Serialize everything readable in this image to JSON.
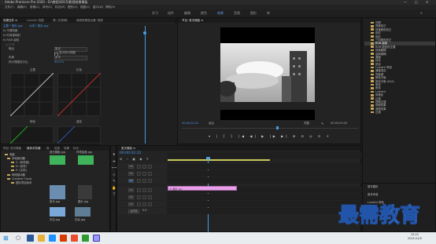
{
  "window": {
    "title": "Adobe Premiere Pro 2020 - D:\\教程\\0015\\影视效果模板",
    "controls": [
      "—",
      "□",
      "✕"
    ]
  },
  "menu": [
    "文件(F)",
    "编辑(E)",
    "剪辑(C)",
    "序列(S)",
    "标记(M)",
    "图形(G)",
    "视图(V)",
    "窗口(W)",
    "帮助(H)"
  ],
  "workspaces": [
    "学习",
    "组件",
    "编辑",
    "颜色",
    "效果",
    "音频",
    "图形",
    "库"
  ],
  "workspace_active_index": 4,
  "effect_controls": {
    "tabs": [
      "效果控件 ≡",
      "Lumetri 范围",
      "源: (无剪辑)",
      "音频剪辑混合器: 视频"
    ],
    "source_label": "主要 * 图片.jpg",
    "clip_label": "大鸡 * 图片.jpg",
    "props": [
      {
        "name": "fx 不透明度"
      },
      {
        "name": "fx 时间重映射"
      },
      {
        "name": "fx RGB 曲线"
      },
      {
        "name": "输出",
        "value": "复合"
      },
      {
        "name": "",
        "value": "显示拆分视图"
      },
      {
        "name": "布局",
        "value": "水平"
      },
      {
        "name": "拆分视图百分比",
        "value": "50.0 %"
      }
    ],
    "curve_labels": [
      "主要",
      "红色",
      "绿色",
      "蓝色"
    ]
  },
  "program_monitor": {
    "tab": "节目: 夏天微距 ≡",
    "timecode_left": "00:00:02:22",
    "fit": "适合",
    "quality": "完整",
    "timecode_right": "00:00:05:00"
  },
  "project": {
    "tabs": [
      "项目: 夏天微距",
      "媒体浏览器",
      "库",
      "信息",
      "效果",
      "标记"
    ],
    "tree": [
      "电脑",
      "本地驱动器",
      "C: (系统盘)",
      "D: (软件)",
      "E: (文档)",
      "网络驱动器",
      "Creative Cloud",
      "团队项目版本"
    ],
    "thumbs": [
      {
        "label": "夏天微距.jpg",
        "color": "#3fb35a"
      },
      {
        "label": "环境拾音.jpg",
        "color": "#3fb35a"
      },
      {
        "label": "夏天.jpg",
        "color": "#6a8db0"
      },
      {
        "label": "图片.jpg",
        "color": "#3a3a3a"
      },
      {
        "label": "天空.jpg",
        "color": "#7aa8d8"
      },
      {
        "label": "花朵.jpg",
        "color": "#5d7e95"
      }
    ]
  },
  "timeline": {
    "tab": "夏天微距 ≡",
    "timecode": "00:00:02:22",
    "tracks": [
      "V3",
      "V2",
      "V1",
      "A1",
      "A2",
      "A3",
      "主声道"
    ],
    "master_value": "0.0",
    "clip_label": "fx 图片.jpg",
    "clip_color": "#e8a0e8"
  },
  "effects_panel": {
    "items": [
      "光照",
      "亮度校正",
      "快速颜色校正",
      "色彩",
      "色阶",
      "三向颜色校正",
      "RGB 曲线",
      "RGB 颜色校正器",
      "快速模糊",
      "高斯模糊",
      "通道",
      "钝化",
      "锐化",
      "Lumetri 预设",
      "通道混合",
      "亮度键",
      "颜色平衡",
      "颜色平衡 (HLS)",
      "单色",
      "颜色",
      "Lumetri",
      "风格化",
      "过渡",
      "视频过渡",
      "视频效果",
      "音频效果",
      "过渡"
    ],
    "selected": "RGB 曲线",
    "bottom": [
      "基本图形",
      "基本声音",
      "Lumetri 颜色"
    ]
  },
  "watermark": "最需教育",
  "taskbar": {
    "time": "15:22",
    "date": "2021/11/5"
  }
}
